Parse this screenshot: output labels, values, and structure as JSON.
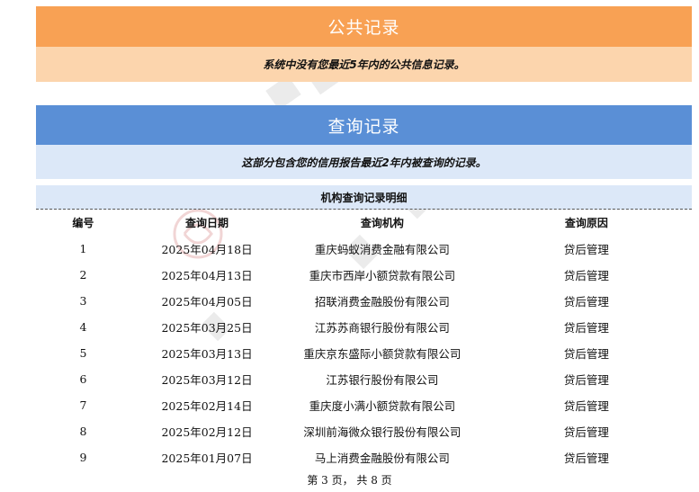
{
  "public_records": {
    "title": "公共记录",
    "note": "系统中没有您最近5年内的公共信息记录。"
  },
  "query_records": {
    "title": "查询记录",
    "note": "这部分包含您的信用报告最近2年内被查询的记录。",
    "subtitle": "机构查询记录明细",
    "columns": [
      "编号",
      "查询日期",
      "查询机构",
      "查询原因"
    ],
    "rows": [
      [
        "1",
        "2025年04月18日",
        "重庆蚂蚁消费金融有限公司",
        "贷后管理"
      ],
      [
        "2",
        "2025年04月13日",
        "重庆市西岸小额贷款有限公司",
        "贷后管理"
      ],
      [
        "3",
        "2025年04月05日",
        "招联消费金融股份有限公司",
        "贷后管理"
      ],
      [
        "4",
        "2025年03月25日",
        "江苏苏商银行股份有限公司",
        "贷后管理"
      ],
      [
        "5",
        "2025年03月13日",
        "重庆京东盛际小额贷款有限公司",
        "贷后管理"
      ],
      [
        "6",
        "2025年03月12日",
        "江苏银行股份有限公司",
        "贷后管理"
      ],
      [
        "7",
        "2025年02月14日",
        "重庆度小满小额贷款有限公司",
        "贷后管理"
      ],
      [
        "8",
        "2025年02月12日",
        "深圳前海微众银行股份有限公司",
        "贷后管理"
      ],
      [
        "9",
        "2025年01月07日",
        "马上消费金融股份有限公司",
        "贷后管理"
      ]
    ]
  },
  "footer": {
    "page_indicator": "第 3 页，  共 8 页"
  },
  "colors": {
    "orange_bar": "#f8a154",
    "orange_note": "#fcd5ad",
    "blue_bar": "#5a8fd6",
    "blue_note": "#dce8f8"
  },
  "watermark": {
    "icon": "seal-watermark-icon"
  }
}
